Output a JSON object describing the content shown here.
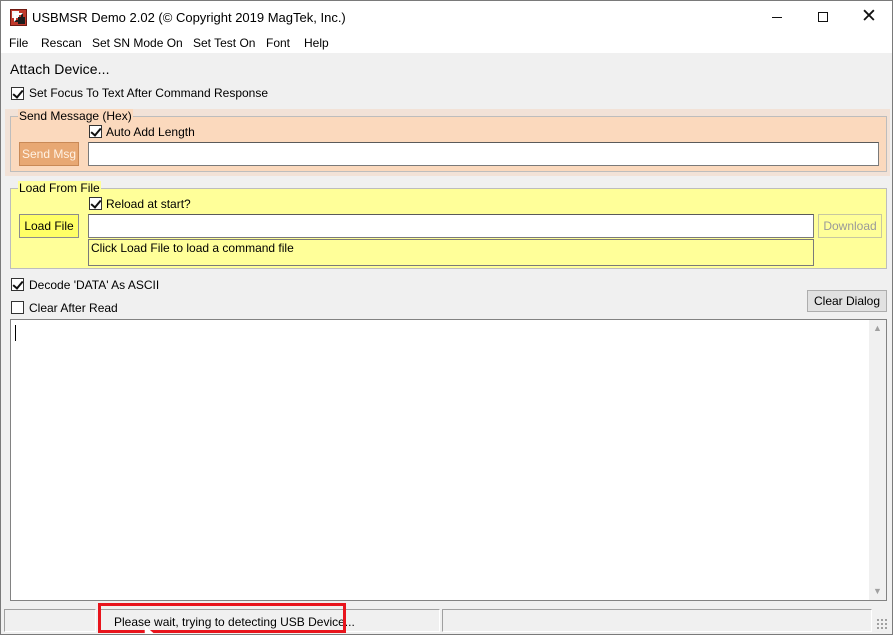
{
  "window": {
    "title": "USBMSR Demo 2.02 (© Copyright 2019 MagTek, Inc.)",
    "controls": {
      "minimize": "—",
      "maximize": "☐",
      "close": "✕"
    }
  },
  "menu": [
    "File",
    "Rescan",
    "Set SN Mode On",
    "Set Test On",
    "Font",
    "Help"
  ],
  "status_heading": "Attach Device...",
  "options": {
    "set_focus": {
      "label": "Set Focus To Text After Command Response",
      "checked": true
    },
    "decode_ascii": {
      "label": "Decode 'DATA' As ASCII",
      "checked": true
    },
    "clear_after_read": {
      "label": "Clear After Read",
      "checked": false
    }
  },
  "send_message": {
    "group_label": "Send Message (Hex)",
    "auto_add_length": {
      "label": "Auto Add Length",
      "checked": true
    },
    "button": "Send Msg",
    "input_value": ""
  },
  "load_from_file": {
    "group_label": "Load From File",
    "reload_at_start": {
      "label": "Reload at start?",
      "checked": true
    },
    "button": "Load File",
    "download_button": "Download",
    "file_value": "",
    "info": "Click Load File to load a command file"
  },
  "clear_dialog": "Clear Dialog",
  "output_text": "",
  "statusbar": {
    "message": "Please wait, trying to detecting USB Device..."
  },
  "colors": {
    "send_group": "#fbd9bd",
    "load_group": "#ffff99",
    "highlight": "#e8141c"
  }
}
